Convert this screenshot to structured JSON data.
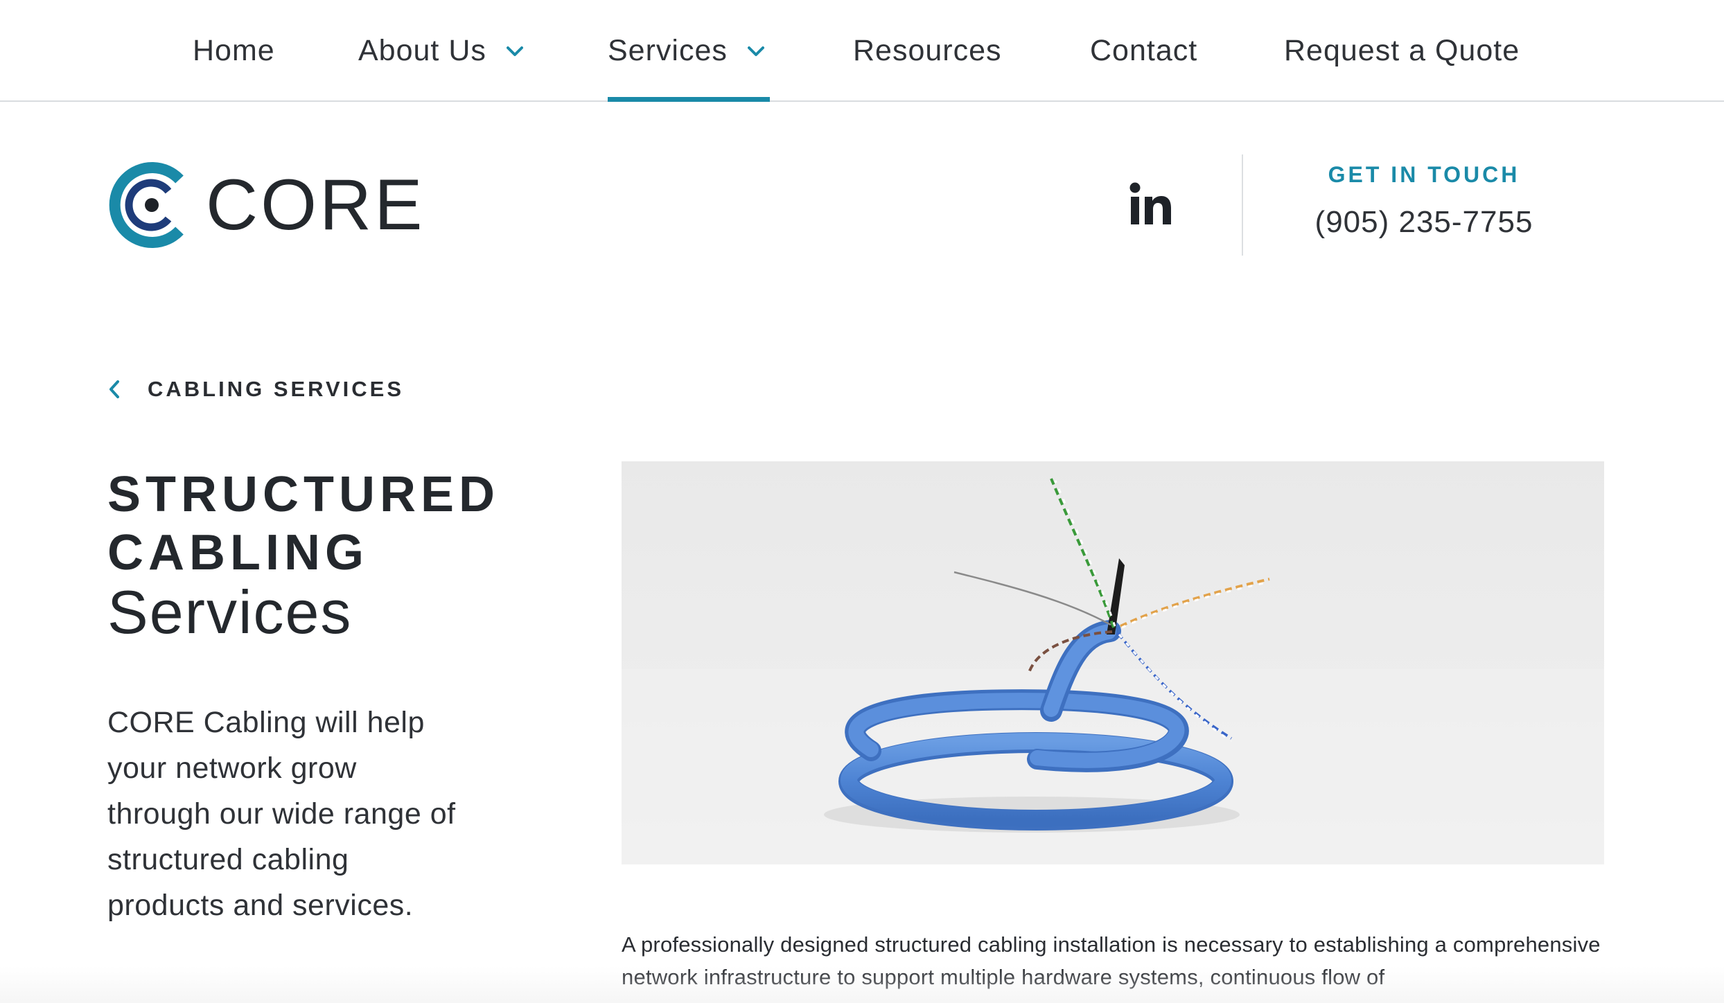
{
  "nav": {
    "items": [
      {
        "label": "Home"
      },
      {
        "label": "About Us"
      },
      {
        "label": "Services"
      },
      {
        "label": "Resources"
      },
      {
        "label": "Contact"
      },
      {
        "label": "Request a Quote"
      }
    ],
    "active": "Services"
  },
  "header": {
    "logo_text": "CORE",
    "social_icon": "linkedin-icon",
    "contact_label": "GET IN TOUCH",
    "phone": "(905) 235-7755"
  },
  "breadcrumb": {
    "back_label": "CABLING SERVICES"
  },
  "hero": {
    "title_line1": "STRUCTURED",
    "title_line2": "CABLING",
    "title_line3": "Services",
    "intro": "CORE Cabling will help your network grow through our wide range of structured cabling products and services."
  },
  "content": {
    "body": "A professionally designed structured cabling installation is necessary to establishing a comprehensive network infrastructure to support multiple hardware systems, continuous flow of"
  },
  "colors": {
    "accent": "#1a8aa8",
    "text_dark": "#24282d",
    "logo_dark_blue": "#1e3c7a",
    "cable_blue": "#4f86d6"
  }
}
